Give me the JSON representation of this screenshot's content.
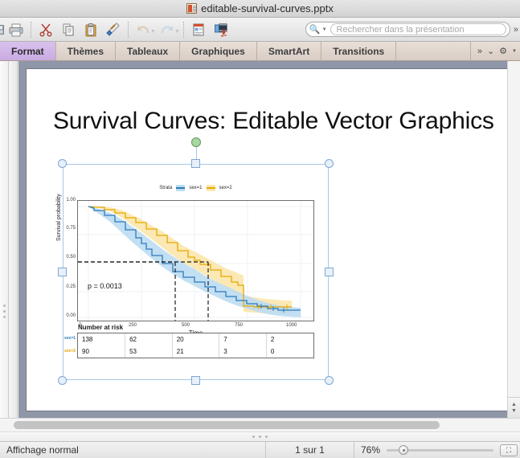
{
  "window": {
    "title": "editable-survival-curves.pptx",
    "doc_icon": "presentation-file-icon"
  },
  "toolbar": {
    "buttons": [
      {
        "name": "save-button",
        "glyph": "■"
      },
      {
        "name": "print-button",
        "glyph": "⎙"
      },
      {
        "name": "cut-button",
        "glyph": "✂"
      },
      {
        "name": "copy-button",
        "glyph": "⧉"
      },
      {
        "name": "paste-button",
        "glyph": "ὌB"
      },
      {
        "name": "format-painter-button",
        "glyph": "✎"
      },
      {
        "name": "undo-button",
        "glyph": "↶"
      },
      {
        "name": "redo-button",
        "glyph": "↷"
      },
      {
        "name": "new-slide-button",
        "glyph": "▤"
      },
      {
        "name": "media-button",
        "glyph": "♫"
      }
    ],
    "search_placeholder": "Rechercher dans la présentation",
    "overflow_glyph": "»"
  },
  "ribbon": {
    "tabs": [
      {
        "label": "Format",
        "active": true
      },
      {
        "label": "Thèmes",
        "active": false
      },
      {
        "label": "Tableaux",
        "active": false
      },
      {
        "label": "Graphiques",
        "active": false
      },
      {
        "label": "SmartArt",
        "active": false
      },
      {
        "label": "Transitions",
        "active": false
      }
    ],
    "overflow": "»",
    "collapse": "⌄",
    "settings": "⚙"
  },
  "slide": {
    "title": "Survival Curves: Editable Vector Graphics"
  },
  "status": {
    "view_mode": "Affichage normal",
    "page": "1 sur 1",
    "zoom": "76%",
    "fit_icon": "fit-to-window-icon"
  },
  "chart_data": {
    "type": "line",
    "title": "",
    "xlabel": "Time",
    "ylabel": "Survival probability",
    "xlim": [
      0,
      1050
    ],
    "ylim": [
      0,
      1
    ],
    "xticks": [
      0,
      250,
      500,
      750,
      1000
    ],
    "xtick_labels": [
      "0",
      "250",
      "500",
      "750",
      "1000"
    ],
    "yticks": [
      0.0,
      0.25,
      0.5,
      0.75,
      1.0
    ],
    "ytick_labels": [
      "0.00",
      "0.25",
      "0.50",
      "0.75",
      "1.00"
    ],
    "grid": true,
    "legend": {
      "title": "Strata",
      "position": "top",
      "entries": [
        {
          "label": "sex=1",
          "color": "#2b7bba",
          "band": "#bcdcf2"
        },
        {
          "label": "sex=2",
          "color": "#e5a900",
          "band": "#fbe7b0"
        }
      ]
    },
    "annotations": [
      {
        "text": "p = 0.0013",
        "x": 60,
        "y": 0.19
      },
      {
        "text": "median-lines",
        "x_sex1": 270,
        "x_sex2": 426,
        "y": 0.5
      }
    ],
    "series": [
      {
        "name": "sex=1",
        "color": "#2b7bba",
        "band_color": "#bcdcf2",
        "x": [
          0,
          30,
          60,
          100,
          145,
          180,
          210,
          230,
          270,
          310,
          350,
          400,
          460,
          520,
          600,
          680,
          760,
          830,
          900,
          1022
        ],
        "y": [
          1.0,
          0.96,
          0.92,
          0.86,
          0.79,
          0.74,
          0.68,
          0.63,
          0.5,
          0.43,
          0.38,
          0.33,
          0.28,
          0.24,
          0.2,
          0.16,
          0.13,
          0.11,
          0.1,
          0.1
        ],
        "lower": [
          1.0,
          0.93,
          0.88,
          0.81,
          0.73,
          0.67,
          0.61,
          0.56,
          0.43,
          0.36,
          0.31,
          0.26,
          0.22,
          0.18,
          0.14,
          0.11,
          0.09,
          0.07,
          0.06,
          0.06
        ],
        "upper": [
          1.0,
          0.99,
          0.96,
          0.91,
          0.85,
          0.81,
          0.75,
          0.7,
          0.58,
          0.51,
          0.46,
          0.41,
          0.35,
          0.31,
          0.27,
          0.23,
          0.19,
          0.17,
          0.16,
          0.16
        ]
      },
      {
        "name": "sex=2",
        "color": "#e5a900",
        "band_color": "#fbe7b0",
        "x": [
          0,
          50,
          110,
          170,
          230,
          290,
          350,
          410,
          430,
          500,
          560,
          620,
          680,
          730,
          760,
          820,
          880,
          960
        ],
        "y": [
          1.0,
          0.97,
          0.92,
          0.86,
          0.8,
          0.72,
          0.62,
          0.52,
          0.5,
          0.43,
          0.38,
          0.34,
          0.3,
          0.29,
          0.13,
          0.11,
          0.1,
          0.1
        ],
        "lower": [
          1.0,
          0.94,
          0.87,
          0.79,
          0.71,
          0.62,
          0.52,
          0.42,
          0.4,
          0.33,
          0.28,
          0.24,
          0.2,
          0.19,
          0.08,
          0.07,
          0.06,
          0.06
        ],
        "upper": [
          1.0,
          1.0,
          0.98,
          0.94,
          0.89,
          0.83,
          0.74,
          0.64,
          0.62,
          0.55,
          0.5,
          0.46,
          0.43,
          0.42,
          0.23,
          0.21,
          0.2,
          0.2
        ]
      }
    ],
    "risk_table": {
      "title": "Number at risk",
      "row_labels": [
        "sex=1",
        "sex=2"
      ],
      "columns": [
        "0",
        "250",
        "500",
        "750",
        "1000"
      ],
      "rows": [
        [
          "138",
          "62",
          "20",
          "7",
          "2"
        ],
        [
          "90",
          "53",
          "21",
          "3",
          "0"
        ]
      ]
    }
  },
  "selection": {
    "rotation_handle": "rotation-handle",
    "handles": 8
  }
}
